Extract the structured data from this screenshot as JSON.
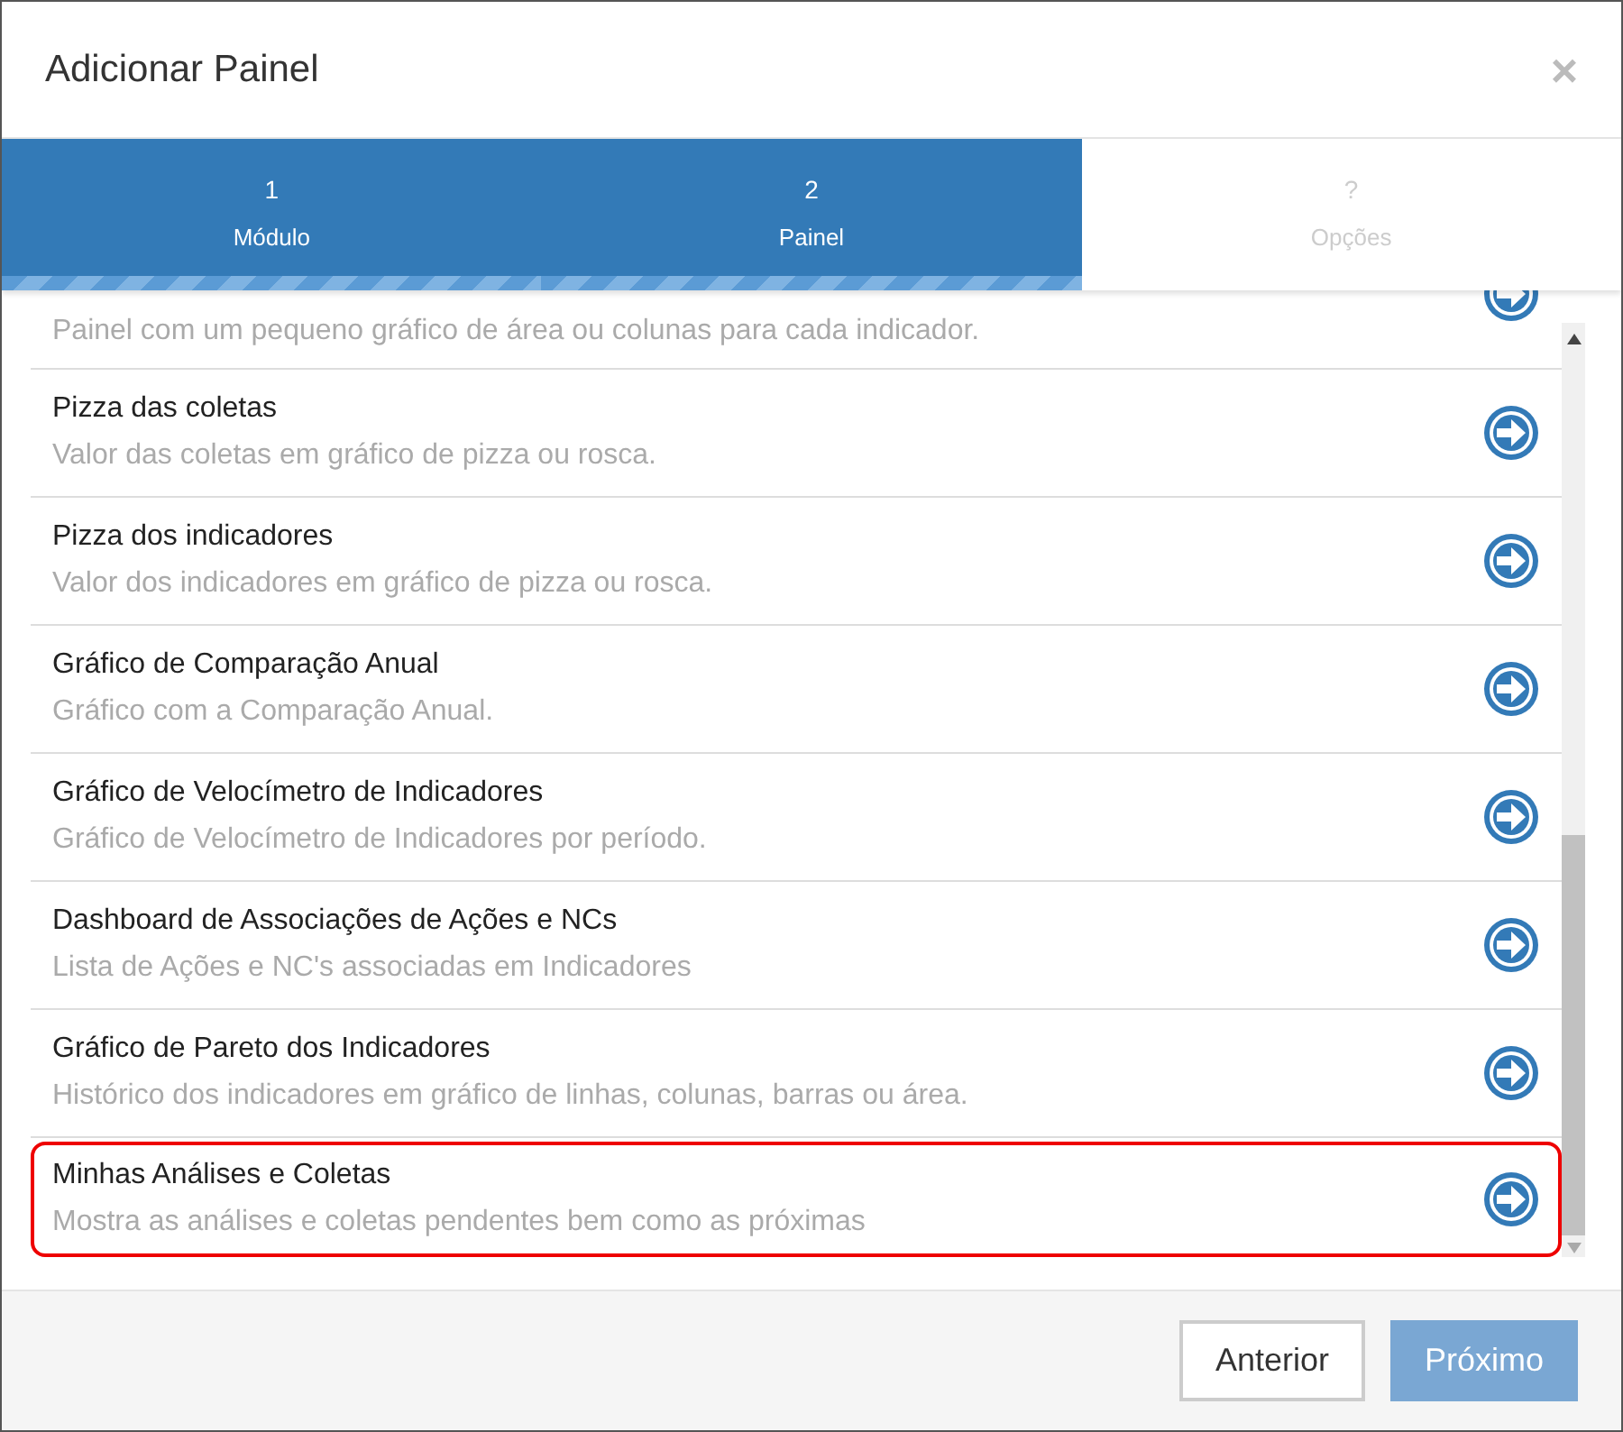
{
  "dialog": {
    "title": "Adicionar Painel",
    "close": "×"
  },
  "steps": [
    {
      "number": "1",
      "label": "Módulo",
      "completed": true
    },
    {
      "number": "2",
      "label": "Painel",
      "completed": true
    },
    {
      "number": "?",
      "label": "Opções",
      "completed": false
    }
  ],
  "panels": [
    {
      "description": "Painel com um pequeno gráfico de área ou colunas para cada indicador.",
      "highlighted": false
    },
    {
      "title": "Pizza das coletas",
      "description": "Valor das coletas em gráfico de pizza ou rosca.",
      "highlighted": false
    },
    {
      "title": "Pizza dos indicadores",
      "description": "Valor dos indicadores em gráfico de pizza ou rosca.",
      "highlighted": false
    },
    {
      "title": "Gráfico de Comparação Anual",
      "description": "Gráfico com a Comparação Anual.",
      "highlighted": false
    },
    {
      "title": "Gráfico de Velocímetro de Indicadores",
      "description": "Gráfico de Velocímetro de Indicadores por período.",
      "highlighted": false
    },
    {
      "title": "Dashboard de Associações de Ações e NCs",
      "description": "Lista de Ações e NC's associadas em Indicadores",
      "highlighted": false
    },
    {
      "title": "Gráfico de Pareto dos Indicadores",
      "description": "Histórico dos indicadores em gráfico de linhas, colunas, barras ou área.",
      "highlighted": false
    },
    {
      "title": "Minhas Análises e Coletas",
      "description": "Mostra as análises e coletas pendentes bem como as próximas",
      "highlighted": true
    }
  ],
  "buttons": [
    {
      "label": "Anterior",
      "kind": "secondary"
    },
    {
      "label": "Próximo",
      "kind": "primary"
    }
  ]
}
